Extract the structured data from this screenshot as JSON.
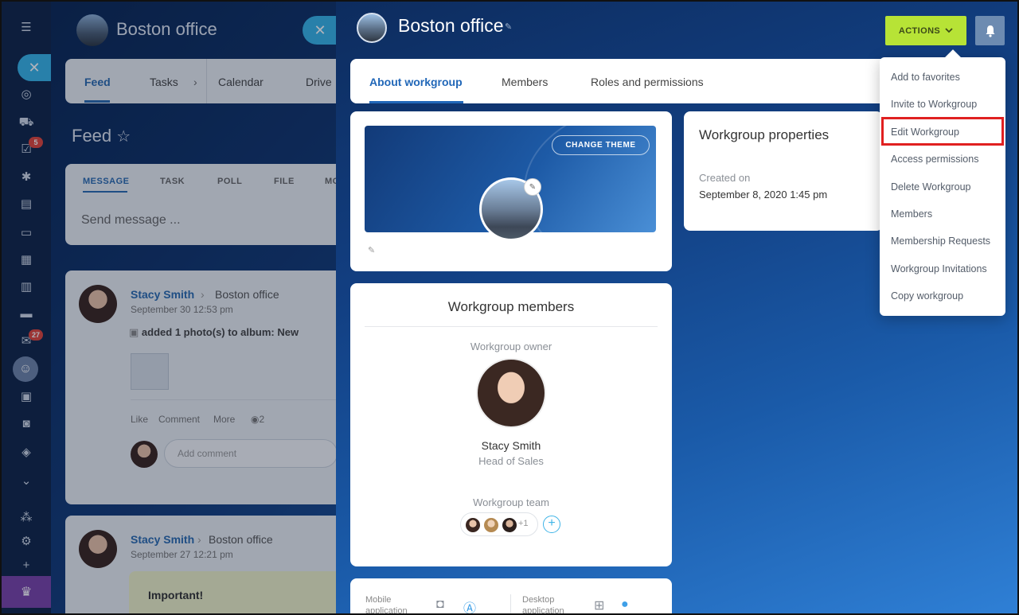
{
  "sidebar": {
    "tasks_badge": "5",
    "mail_badge": "27"
  },
  "background": {
    "header_title": "Boston office",
    "tabs": [
      "Feed",
      "Tasks",
      "Calendar",
      "Drive"
    ],
    "feed_title": "Feed",
    "composer_tabs": [
      "MESSAGE",
      "TASK",
      "POLL",
      "FILE",
      "MO"
    ],
    "composer_placeholder": "Send message ...",
    "posts": [
      {
        "author": "Stacy Smith",
        "target": "Boston office",
        "date": "September 30 12:53 pm",
        "action": "added 1 photo(s) to album: New",
        "links": [
          "Like",
          "Comment",
          "More"
        ],
        "views": "2",
        "comment_placeholder": "Add comment"
      },
      {
        "author": "Stacy Smith",
        "target": "Boston office",
        "date": "September 27 12:21 pm",
        "important": "Important!"
      }
    ]
  },
  "panel": {
    "title": "Boston office",
    "actions_label": "ACTIONS",
    "tabs": [
      "About workgroup",
      "Members",
      "Roles and permissions"
    ],
    "change_theme_label": "CHANGE THEME",
    "properties": {
      "title": "Workgroup properties",
      "created_label": "Created on",
      "created_value": "September 8, 2020 1:45 pm"
    },
    "members": {
      "title": "Workgroup members",
      "owner_label": "Workgroup owner",
      "owner_name": "Stacy Smith",
      "owner_role": "Head of Sales",
      "team_label": "Workgroup team",
      "team_more": "+1"
    },
    "apps": {
      "mobile_label": "Mobile application",
      "desktop_label": "Desktop application"
    }
  },
  "dropdown": {
    "items": [
      "Add to favorites",
      "Invite to Workgroup",
      "Edit Workgroup",
      "Access permissions",
      "Delete Workgroup",
      "Members",
      "Membership Requests",
      "Workgroup Invitations",
      "Copy workgroup"
    ],
    "highlighted": "Edit Workgroup"
  },
  "colors": {
    "accent": "#2167b8",
    "actions_button": "#b7e336",
    "highlight_box": "#e02020",
    "arrow": "#e82323"
  }
}
